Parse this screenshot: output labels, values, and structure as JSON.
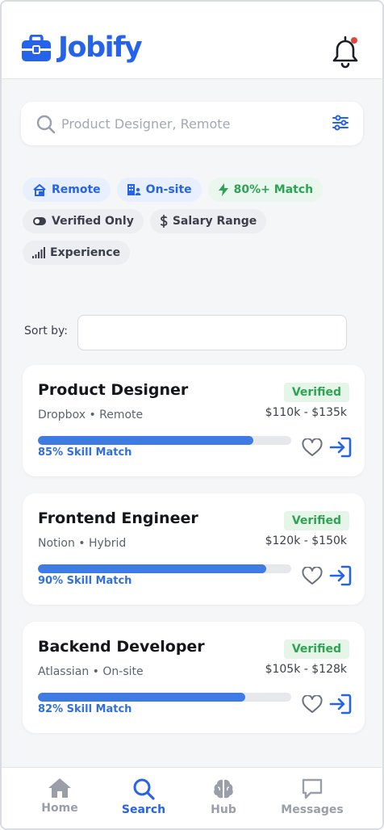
{
  "app": {
    "name": "Jobify"
  },
  "header": {
    "notification_dot_color": "#e0483e",
    "icons": [
      "briefcase-icon",
      "bell-icon"
    ]
  },
  "search": {
    "placeholder": "Product Designer, Remote",
    "value": ""
  },
  "filters": [
    {
      "label": "Remote",
      "icon": "home-icon",
      "style": "blue"
    },
    {
      "label": "On-site",
      "icon": "building-icon",
      "style": "blue"
    },
    {
      "label": "80%+ Match",
      "icon": "bolt-icon",
      "style": "green"
    },
    {
      "label": "Verified Only",
      "icon": "toggle-icon",
      "style": "gray"
    },
    {
      "label": "Salary Range",
      "icon": "dollar-icon",
      "style": "gray"
    },
    {
      "label": "Experience",
      "icon": "signal-icon",
      "style": "gray"
    }
  ],
  "sort": {
    "label": "Sort by:",
    "value": ""
  },
  "jobs": [
    {
      "title": "Product Designer",
      "company": "Dropbox • Remote",
      "badge": "Verified",
      "salary": "$110k - $135k",
      "match_percent": 85,
      "match_label": "85% Skill Match"
    },
    {
      "title": "Frontend Engineer",
      "company": "Notion • Hybrid",
      "badge": "Verified",
      "salary": "$120k - $150k",
      "match_percent": 90,
      "match_label": "90% Skill Match"
    },
    {
      "title": "Backend Developer",
      "company": "Atlassian • On-site",
      "badge": "Verified",
      "salary": "$105k - $128k",
      "match_percent": 82,
      "match_label": "82% Skill Match"
    }
  ],
  "nav": [
    {
      "label": "Home",
      "icon": "home-icon",
      "active": false
    },
    {
      "label": "Search",
      "icon": "search-icon",
      "active": true
    },
    {
      "label": "Hub",
      "icon": "brain-icon",
      "active": false
    },
    {
      "label": "Messages",
      "icon": "message-icon",
      "active": false
    }
  ],
  "colors": {
    "accent": "#2563eb",
    "verified": "#2ea354",
    "progress": "#3e7be3"
  }
}
